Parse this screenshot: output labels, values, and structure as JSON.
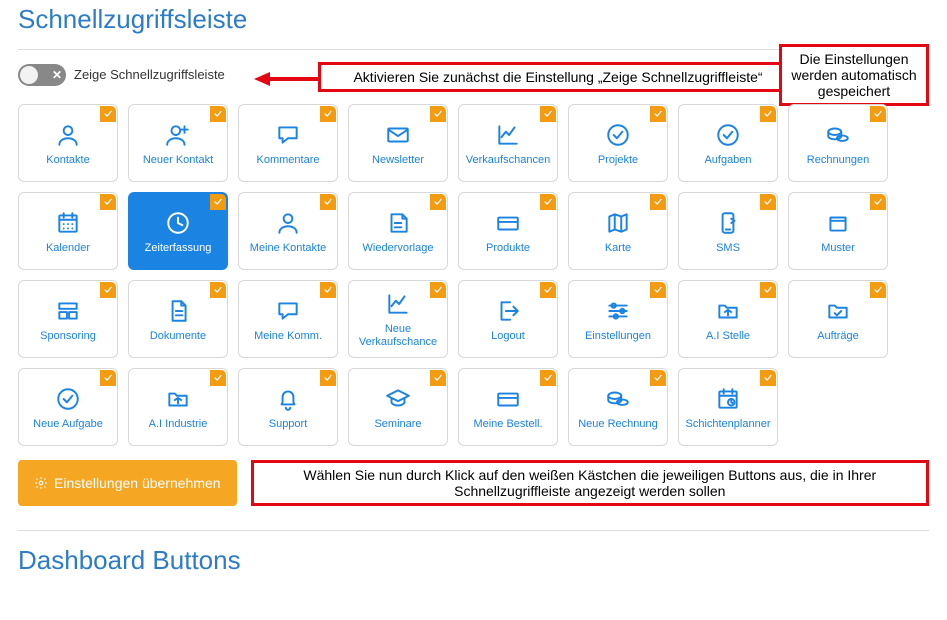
{
  "title": "Schnellzugriffsleiste",
  "toggle": {
    "label": "Zeige Schnellzugriffsleiste",
    "on": false
  },
  "callouts": {
    "activate": "Aktivieren Sie zunächst die Einstellung „Zeige Schnellzugriffleiste“",
    "saved": "Die Einstellungen werden automatisch gespeichert",
    "select": "Wählen Sie nun durch Klick auf den weißen Kästchen die jeweiligen Buttons aus, die in Ihrer Schnellzugriffleiste angezeigt werden sollen"
  },
  "apply_label": "Einstellungen übernehmen",
  "dashboard_title": "Dashboard Buttons",
  "tiles": [
    {
      "label": "Kontakte",
      "icon": "person-icon",
      "checked": true
    },
    {
      "label": "Neuer Kontakt",
      "icon": "person-plus-icon",
      "checked": true
    },
    {
      "label": "Kommentare",
      "icon": "speech-icon",
      "checked": true
    },
    {
      "label": "Newsletter",
      "icon": "envelope-icon",
      "checked": true
    },
    {
      "label": "Verkaufschancen",
      "icon": "chart-icon",
      "checked": true
    },
    {
      "label": "Projekte",
      "icon": "check-circle-icon",
      "checked": true
    },
    {
      "label": "Aufgaben",
      "icon": "check-circle-icon",
      "checked": true
    },
    {
      "label": "Rechnungen",
      "icon": "coins-icon",
      "checked": true
    },
    {
      "label": "Kalender",
      "icon": "calendar-grid-icon",
      "checked": true
    },
    {
      "label": "Zeiterfassung",
      "icon": "clock-icon",
      "checked": true,
      "active": true
    },
    {
      "label": "Meine Kontakte",
      "icon": "person-icon",
      "checked": true
    },
    {
      "label": "Wiedervorlage",
      "icon": "note-icon",
      "checked": true
    },
    {
      "label": "Produkte",
      "icon": "card-icon",
      "checked": true
    },
    {
      "label": "Karte",
      "icon": "map-icon",
      "checked": true
    },
    {
      "label": "SMS",
      "icon": "sms-icon",
      "checked": true
    },
    {
      "label": "Muster",
      "icon": "box-icon",
      "checked": true
    },
    {
      "label": "Sponsoring",
      "icon": "layout-icon",
      "checked": true
    },
    {
      "label": "Dokumente",
      "icon": "document-icon",
      "checked": true
    },
    {
      "label": "Meine Komm.",
      "icon": "speech-icon",
      "checked": true
    },
    {
      "label": "Neue Verkaufschance",
      "icon": "chart-icon",
      "checked": true
    },
    {
      "label": "Logout",
      "icon": "logout-icon",
      "checked": true
    },
    {
      "label": "Einstellungen",
      "icon": "sliders-icon",
      "checked": true
    },
    {
      "label": "A.I Stelle",
      "icon": "folder-in-icon",
      "checked": true
    },
    {
      "label": "Aufträge",
      "icon": "folder-check-icon",
      "checked": true
    },
    {
      "label": "Neue Aufgabe",
      "icon": "check-circle-icon",
      "checked": true
    },
    {
      "label": "A.I Industrie",
      "icon": "folder-in-icon",
      "checked": true
    },
    {
      "label": "Support",
      "icon": "bell-icon",
      "checked": true
    },
    {
      "label": "Seminare",
      "icon": "graduation-icon",
      "checked": true
    },
    {
      "label": "Meine Bestell.",
      "icon": "card-icon",
      "checked": true
    },
    {
      "label": "Neue Rechnung",
      "icon": "coins-icon",
      "checked": true
    },
    {
      "label": "Schichtenplanner",
      "icon": "calendar-clock-icon",
      "checked": true
    }
  ]
}
